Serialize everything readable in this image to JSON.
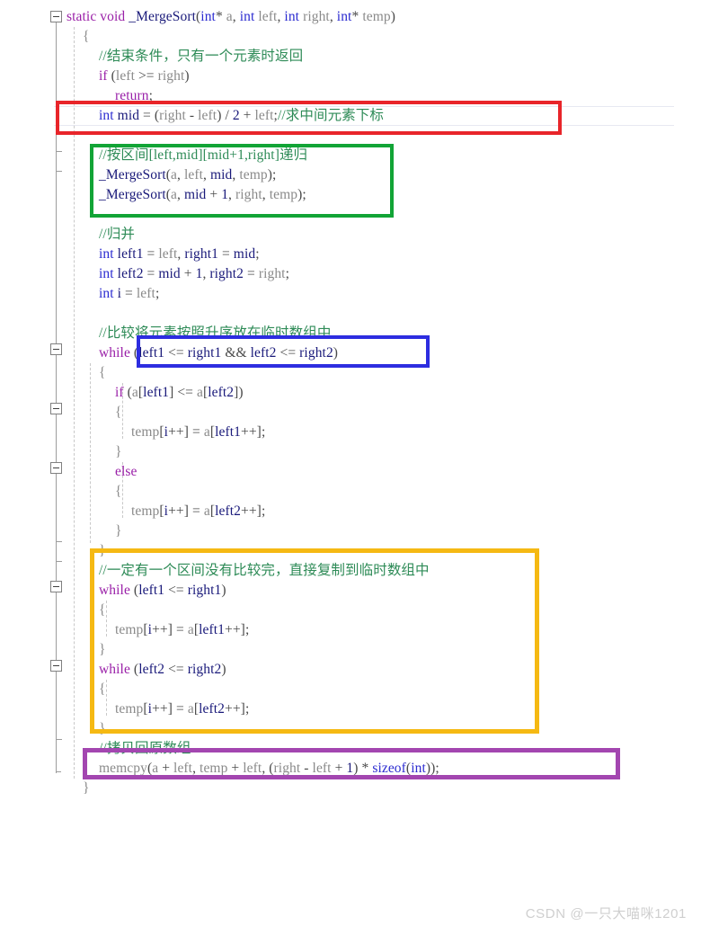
{
  "editor": {
    "language": "C",
    "background_color": "#ffffff",
    "watermark": "CSDN @一只大喵咪1201",
    "syntax_colors": {
      "keyword": "#9a20a8",
      "type": "#2b2bd0",
      "function": "#1a1a7a",
      "local_variable": "#19197a",
      "parameter": "#8a8a8a",
      "comment": "#2e8b57",
      "punctuation": "#4a4a4a"
    },
    "current_line_highlight_color": "#e7e9f2"
  },
  "annotations": [
    {
      "name": "mid-calculation-box",
      "color": "#e8252a",
      "label": "red"
    },
    {
      "name": "recursive-calls-box",
      "color": "#12a436",
      "label": "green"
    },
    {
      "name": "merge-while-condition-box",
      "color": "#2d2de0",
      "label": "blue"
    },
    {
      "name": "copy-remainder-box",
      "color": "#f5b913",
      "label": "yellow"
    },
    {
      "name": "memcpy-back-box",
      "color": "#a346b0",
      "label": "purple"
    }
  ],
  "code": {
    "lines": [
      {
        "n": 1,
        "tokens": [
          {
            "t": "static",
            "c": "kw"
          },
          {
            "t": " ",
            "c": "pun"
          },
          {
            "t": "void",
            "c": "kw"
          },
          {
            "t": " ",
            "c": "pun"
          },
          {
            "t": "_MergeSort",
            "c": "fn"
          },
          {
            "t": "(",
            "c": "pun"
          },
          {
            "t": "int",
            "c": "typ"
          },
          {
            "t": "*",
            "c": "pun"
          },
          {
            "t": " ",
            "c": "pun"
          },
          {
            "t": "a",
            "c": "par"
          },
          {
            "t": ", ",
            "c": "pun"
          },
          {
            "t": "int",
            "c": "typ"
          },
          {
            "t": " ",
            "c": "pun"
          },
          {
            "t": "left",
            "c": "par"
          },
          {
            "t": ", ",
            "c": "pun"
          },
          {
            "t": "int",
            "c": "typ"
          },
          {
            "t": " ",
            "c": "pun"
          },
          {
            "t": "right",
            "c": "par"
          },
          {
            "t": ", ",
            "c": "pun"
          },
          {
            "t": "int",
            "c": "typ"
          },
          {
            "t": "*",
            "c": "pun"
          },
          {
            "t": " ",
            "c": "pun"
          },
          {
            "t": "temp",
            "c": "par"
          },
          {
            "t": ")",
            "c": "pun"
          }
        ]
      },
      {
        "n": 2,
        "tokens": [
          {
            "t": "{",
            "c": "brc"
          }
        ],
        "indent": 1
      },
      {
        "n": 3,
        "tokens": [
          {
            "t": "//结束条件，只有一个元素时返回",
            "c": "cmt"
          }
        ],
        "indent": 2
      },
      {
        "n": 4,
        "tokens": [
          {
            "t": "if",
            "c": "kw"
          },
          {
            "t": " (",
            "c": "pun"
          },
          {
            "t": "left",
            "c": "par"
          },
          {
            "t": " >= ",
            "c": "pun"
          },
          {
            "t": "right",
            "c": "par"
          },
          {
            "t": ")",
            "c": "pun"
          }
        ],
        "indent": 2
      },
      {
        "n": 5,
        "tokens": [
          {
            "t": "return",
            "c": "kw"
          },
          {
            "t": ";",
            "c": "pun"
          }
        ],
        "indent": 3
      },
      {
        "n": 6,
        "tokens": [
          {
            "t": "int",
            "c": "typ"
          },
          {
            "t": " ",
            "c": "pun"
          },
          {
            "t": "mid",
            "c": "loc"
          },
          {
            "t": " = (",
            "c": "pun"
          },
          {
            "t": "right",
            "c": "par"
          },
          {
            "t": " - ",
            "c": "pun"
          },
          {
            "t": "left",
            "c": "par"
          },
          {
            "t": ") / ",
            "c": "pun"
          },
          {
            "t": "2",
            "c": "num"
          },
          {
            "t": " + ",
            "c": "pun"
          },
          {
            "t": "left",
            "c": "par"
          },
          {
            "t": ";",
            "c": "pun"
          },
          {
            "t": "//求中间元素下标",
            "c": "cmt"
          }
        ],
        "indent": 2
      },
      {
        "n": 7,
        "tokens": []
      },
      {
        "n": 8,
        "tokens": [
          {
            "t": "//按区间[left,mid][mid+1,right]递归",
            "c": "cmt"
          }
        ],
        "indent": 2
      },
      {
        "n": 9,
        "tokens": [
          {
            "t": "_MergeSort",
            "c": "fn"
          },
          {
            "t": "(",
            "c": "pun"
          },
          {
            "t": "a",
            "c": "par"
          },
          {
            "t": ", ",
            "c": "pun"
          },
          {
            "t": "left",
            "c": "par"
          },
          {
            "t": ", ",
            "c": "pun"
          },
          {
            "t": "mid",
            "c": "loc"
          },
          {
            "t": ", ",
            "c": "pun"
          },
          {
            "t": "temp",
            "c": "par"
          },
          {
            "t": ");",
            "c": "pun"
          }
        ],
        "indent": 2
      },
      {
        "n": 10,
        "tokens": [
          {
            "t": "_MergeSort",
            "c": "fn"
          },
          {
            "t": "(",
            "c": "pun"
          },
          {
            "t": "a",
            "c": "par"
          },
          {
            "t": ", ",
            "c": "pun"
          },
          {
            "t": "mid",
            "c": "loc"
          },
          {
            "t": " + ",
            "c": "pun"
          },
          {
            "t": "1",
            "c": "num"
          },
          {
            "t": ", ",
            "c": "pun"
          },
          {
            "t": "right",
            "c": "par"
          },
          {
            "t": ", ",
            "c": "pun"
          },
          {
            "t": "temp",
            "c": "par"
          },
          {
            "t": ");",
            "c": "pun"
          }
        ],
        "indent": 2
      },
      {
        "n": 11,
        "tokens": []
      },
      {
        "n": 12,
        "tokens": [
          {
            "t": "//归并",
            "c": "cmt"
          }
        ],
        "indent": 2
      },
      {
        "n": 13,
        "tokens": [
          {
            "t": "int",
            "c": "typ"
          },
          {
            "t": " ",
            "c": "pun"
          },
          {
            "t": "left1",
            "c": "loc"
          },
          {
            "t": " = ",
            "c": "pun"
          },
          {
            "t": "left",
            "c": "par"
          },
          {
            "t": ", ",
            "c": "pun"
          },
          {
            "t": "right1",
            "c": "loc"
          },
          {
            "t": " = ",
            "c": "pun"
          },
          {
            "t": "mid",
            "c": "loc"
          },
          {
            "t": ";",
            "c": "pun"
          }
        ],
        "indent": 2
      },
      {
        "n": 14,
        "tokens": [
          {
            "t": "int",
            "c": "typ"
          },
          {
            "t": " ",
            "c": "pun"
          },
          {
            "t": "left2",
            "c": "loc"
          },
          {
            "t": " = ",
            "c": "pun"
          },
          {
            "t": "mid",
            "c": "loc"
          },
          {
            "t": " + ",
            "c": "pun"
          },
          {
            "t": "1",
            "c": "num"
          },
          {
            "t": ", ",
            "c": "pun"
          },
          {
            "t": "right2",
            "c": "loc"
          },
          {
            "t": " = ",
            "c": "pun"
          },
          {
            "t": "right",
            "c": "par"
          },
          {
            "t": ";",
            "c": "pun"
          }
        ],
        "indent": 2
      },
      {
        "n": 15,
        "tokens": [
          {
            "t": "int",
            "c": "typ"
          },
          {
            "t": " ",
            "c": "pun"
          },
          {
            "t": "i",
            "c": "loc"
          },
          {
            "t": " = ",
            "c": "pun"
          },
          {
            "t": "left",
            "c": "par"
          },
          {
            "t": ";",
            "c": "pun"
          }
        ],
        "indent": 2
      },
      {
        "n": 16,
        "tokens": []
      },
      {
        "n": 17,
        "tokens": [
          {
            "t": "//比较将元素按照升序放在临时数组中",
            "c": "cmt"
          }
        ],
        "indent": 2
      },
      {
        "n": 18,
        "tokens": [
          {
            "t": "while",
            "c": "kw"
          },
          {
            "t": " (",
            "c": "pun"
          },
          {
            "t": "left1",
            "c": "loc"
          },
          {
            "t": " <= ",
            "c": "pun"
          },
          {
            "t": "right1",
            "c": "loc"
          },
          {
            "t": " && ",
            "c": "pun"
          },
          {
            "t": "left2",
            "c": "loc"
          },
          {
            "t": " <= ",
            "c": "pun"
          },
          {
            "t": "right2",
            "c": "loc"
          },
          {
            "t": ")",
            "c": "pun"
          }
        ],
        "indent": 2
      },
      {
        "n": 19,
        "tokens": [
          {
            "t": "{",
            "c": "brc"
          }
        ],
        "indent": 2
      },
      {
        "n": 20,
        "tokens": [
          {
            "t": "if",
            "c": "kw"
          },
          {
            "t": " (",
            "c": "pun"
          },
          {
            "t": "a",
            "c": "par"
          },
          {
            "t": "[",
            "c": "pun"
          },
          {
            "t": "left1",
            "c": "loc"
          },
          {
            "t": "] <= ",
            "c": "pun"
          },
          {
            "t": "a",
            "c": "par"
          },
          {
            "t": "[",
            "c": "pun"
          },
          {
            "t": "left2",
            "c": "loc"
          },
          {
            "t": "])",
            "c": "pun"
          }
        ],
        "indent": 3
      },
      {
        "n": 21,
        "tokens": [
          {
            "t": "{",
            "c": "brc"
          }
        ],
        "indent": 3
      },
      {
        "n": 22,
        "tokens": [
          {
            "t": "temp",
            "c": "par"
          },
          {
            "t": "[",
            "c": "pun"
          },
          {
            "t": "i",
            "c": "loc"
          },
          {
            "t": "++] = ",
            "c": "pun"
          },
          {
            "t": "a",
            "c": "par"
          },
          {
            "t": "[",
            "c": "pun"
          },
          {
            "t": "left1",
            "c": "loc"
          },
          {
            "t": "++];",
            "c": "pun"
          }
        ],
        "indent": 4
      },
      {
        "n": 23,
        "tokens": [
          {
            "t": "}",
            "c": "brc"
          }
        ],
        "indent": 3
      },
      {
        "n": 24,
        "tokens": [
          {
            "t": "else",
            "c": "kw"
          }
        ],
        "indent": 3
      },
      {
        "n": 25,
        "tokens": [
          {
            "t": "{",
            "c": "brc"
          }
        ],
        "indent": 3
      },
      {
        "n": 26,
        "tokens": [
          {
            "t": "temp",
            "c": "par"
          },
          {
            "t": "[",
            "c": "pun"
          },
          {
            "t": "i",
            "c": "loc"
          },
          {
            "t": "++] = ",
            "c": "pun"
          },
          {
            "t": "a",
            "c": "par"
          },
          {
            "t": "[",
            "c": "pun"
          },
          {
            "t": "left2",
            "c": "loc"
          },
          {
            "t": "++];",
            "c": "pun"
          }
        ],
        "indent": 4
      },
      {
        "n": 27,
        "tokens": [
          {
            "t": "}",
            "c": "brc"
          }
        ],
        "indent": 3
      },
      {
        "n": 28,
        "tokens": [
          {
            "t": "}",
            "c": "brc"
          }
        ],
        "indent": 2
      },
      {
        "n": 29,
        "tokens": [
          {
            "t": "//一定有一个区间没有比较完，直接复制到临时数组中",
            "c": "cmt"
          }
        ],
        "indent": 2
      },
      {
        "n": 30,
        "tokens": [
          {
            "t": "while",
            "c": "kw"
          },
          {
            "t": " (",
            "c": "pun"
          },
          {
            "t": "left1",
            "c": "loc"
          },
          {
            "t": " <= ",
            "c": "pun"
          },
          {
            "t": "right1",
            "c": "loc"
          },
          {
            "t": ")",
            "c": "pun"
          }
        ],
        "indent": 2
      },
      {
        "n": 31,
        "tokens": [
          {
            "t": "{",
            "c": "brc"
          }
        ],
        "indent": 2
      },
      {
        "n": 32,
        "tokens": [
          {
            "t": "temp",
            "c": "par"
          },
          {
            "t": "[",
            "c": "pun"
          },
          {
            "t": "i",
            "c": "loc"
          },
          {
            "t": "++] = ",
            "c": "pun"
          },
          {
            "t": "a",
            "c": "par"
          },
          {
            "t": "[",
            "c": "pun"
          },
          {
            "t": "left1",
            "c": "loc"
          },
          {
            "t": "++];",
            "c": "pun"
          }
        ],
        "indent": 3
      },
      {
        "n": 33,
        "tokens": [
          {
            "t": "}",
            "c": "brc"
          }
        ],
        "indent": 2
      },
      {
        "n": 34,
        "tokens": [
          {
            "t": "while",
            "c": "kw"
          },
          {
            "t": " (",
            "c": "pun"
          },
          {
            "t": "left2",
            "c": "loc"
          },
          {
            "t": " <= ",
            "c": "pun"
          },
          {
            "t": "right2",
            "c": "loc"
          },
          {
            "t": ")",
            "c": "pun"
          }
        ],
        "indent": 2
      },
      {
        "n": 35,
        "tokens": [
          {
            "t": "{",
            "c": "brc"
          }
        ],
        "indent": 2
      },
      {
        "n": 36,
        "tokens": [
          {
            "t": "temp",
            "c": "par"
          },
          {
            "t": "[",
            "c": "pun"
          },
          {
            "t": "i",
            "c": "loc"
          },
          {
            "t": "++] = ",
            "c": "pun"
          },
          {
            "t": "a",
            "c": "par"
          },
          {
            "t": "[",
            "c": "pun"
          },
          {
            "t": "left2",
            "c": "loc"
          },
          {
            "t": "++];",
            "c": "pun"
          }
        ],
        "indent": 3
      },
      {
        "n": 37,
        "tokens": [
          {
            "t": "}",
            "c": "brc"
          }
        ],
        "indent": 2
      },
      {
        "n": 38,
        "tokens": [
          {
            "t": "//拷贝回原数组",
            "c": "cmt"
          }
        ],
        "indent": 2
      },
      {
        "n": 39,
        "tokens": [
          {
            "t": "memcpy",
            "c": "par"
          },
          {
            "t": "(",
            "c": "pun"
          },
          {
            "t": "a",
            "c": "par"
          },
          {
            "t": " + ",
            "c": "pun"
          },
          {
            "t": "left",
            "c": "par"
          },
          {
            "t": ", ",
            "c": "pun"
          },
          {
            "t": "temp",
            "c": "par"
          },
          {
            "t": " + ",
            "c": "pun"
          },
          {
            "t": "left",
            "c": "par"
          },
          {
            "t": ", (",
            "c": "pun"
          },
          {
            "t": "right",
            "c": "par"
          },
          {
            "t": " - ",
            "c": "pun"
          },
          {
            "t": "left",
            "c": "par"
          },
          {
            "t": " + ",
            "c": "pun"
          },
          {
            "t": "1",
            "c": "num"
          },
          {
            "t": ") * ",
            "c": "pun"
          },
          {
            "t": "sizeof",
            "c": "typ"
          },
          {
            "t": "(",
            "c": "pun"
          },
          {
            "t": "int",
            "c": "typ"
          },
          {
            "t": "));",
            "c": "pun"
          }
        ],
        "indent": 2
      },
      {
        "n": 40,
        "tokens": [
          {
            "t": "}",
            "c": "brc"
          }
        ],
        "indent": 1
      }
    ]
  }
}
